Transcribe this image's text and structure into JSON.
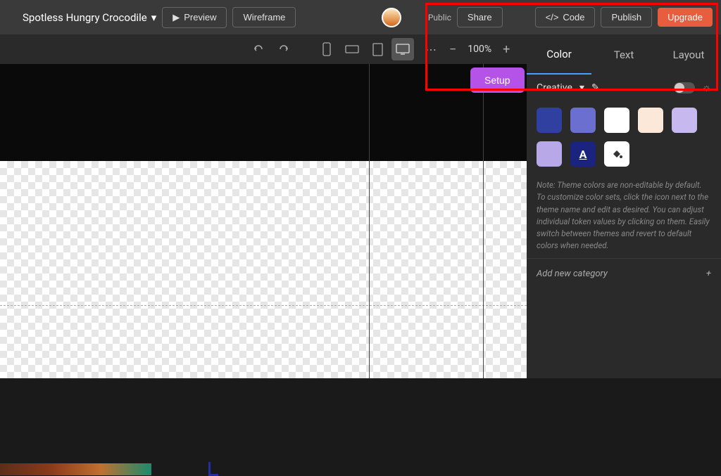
{
  "topbar": {
    "project_name": "Spotless Hungry Crocodile",
    "preview": "Preview",
    "wireframe": "Wireframe",
    "public": "Public",
    "share": "Share",
    "code": "Code",
    "publish": "Publish",
    "upgrade": "Upgrade"
  },
  "zoom": {
    "level": "100%"
  },
  "setup": "Setup",
  "panel": {
    "tabs": {
      "color": "Color",
      "text": "Text",
      "layout": "Layout"
    },
    "theme_name": "Creative",
    "swatches": [
      "#3040a0",
      "#6a6fd0",
      "#ffffff",
      "#fce8d8",
      "#c8b8f0",
      "#b8a8e8"
    ],
    "note": "Note: Theme colors are non-editable by default. To customize color sets, click the icon next to the theme name and edit as desired. You can adjust individual token values by clicking on them. Easily switch between themes and revert to default colors when needed.",
    "add_category": "Add new category"
  }
}
